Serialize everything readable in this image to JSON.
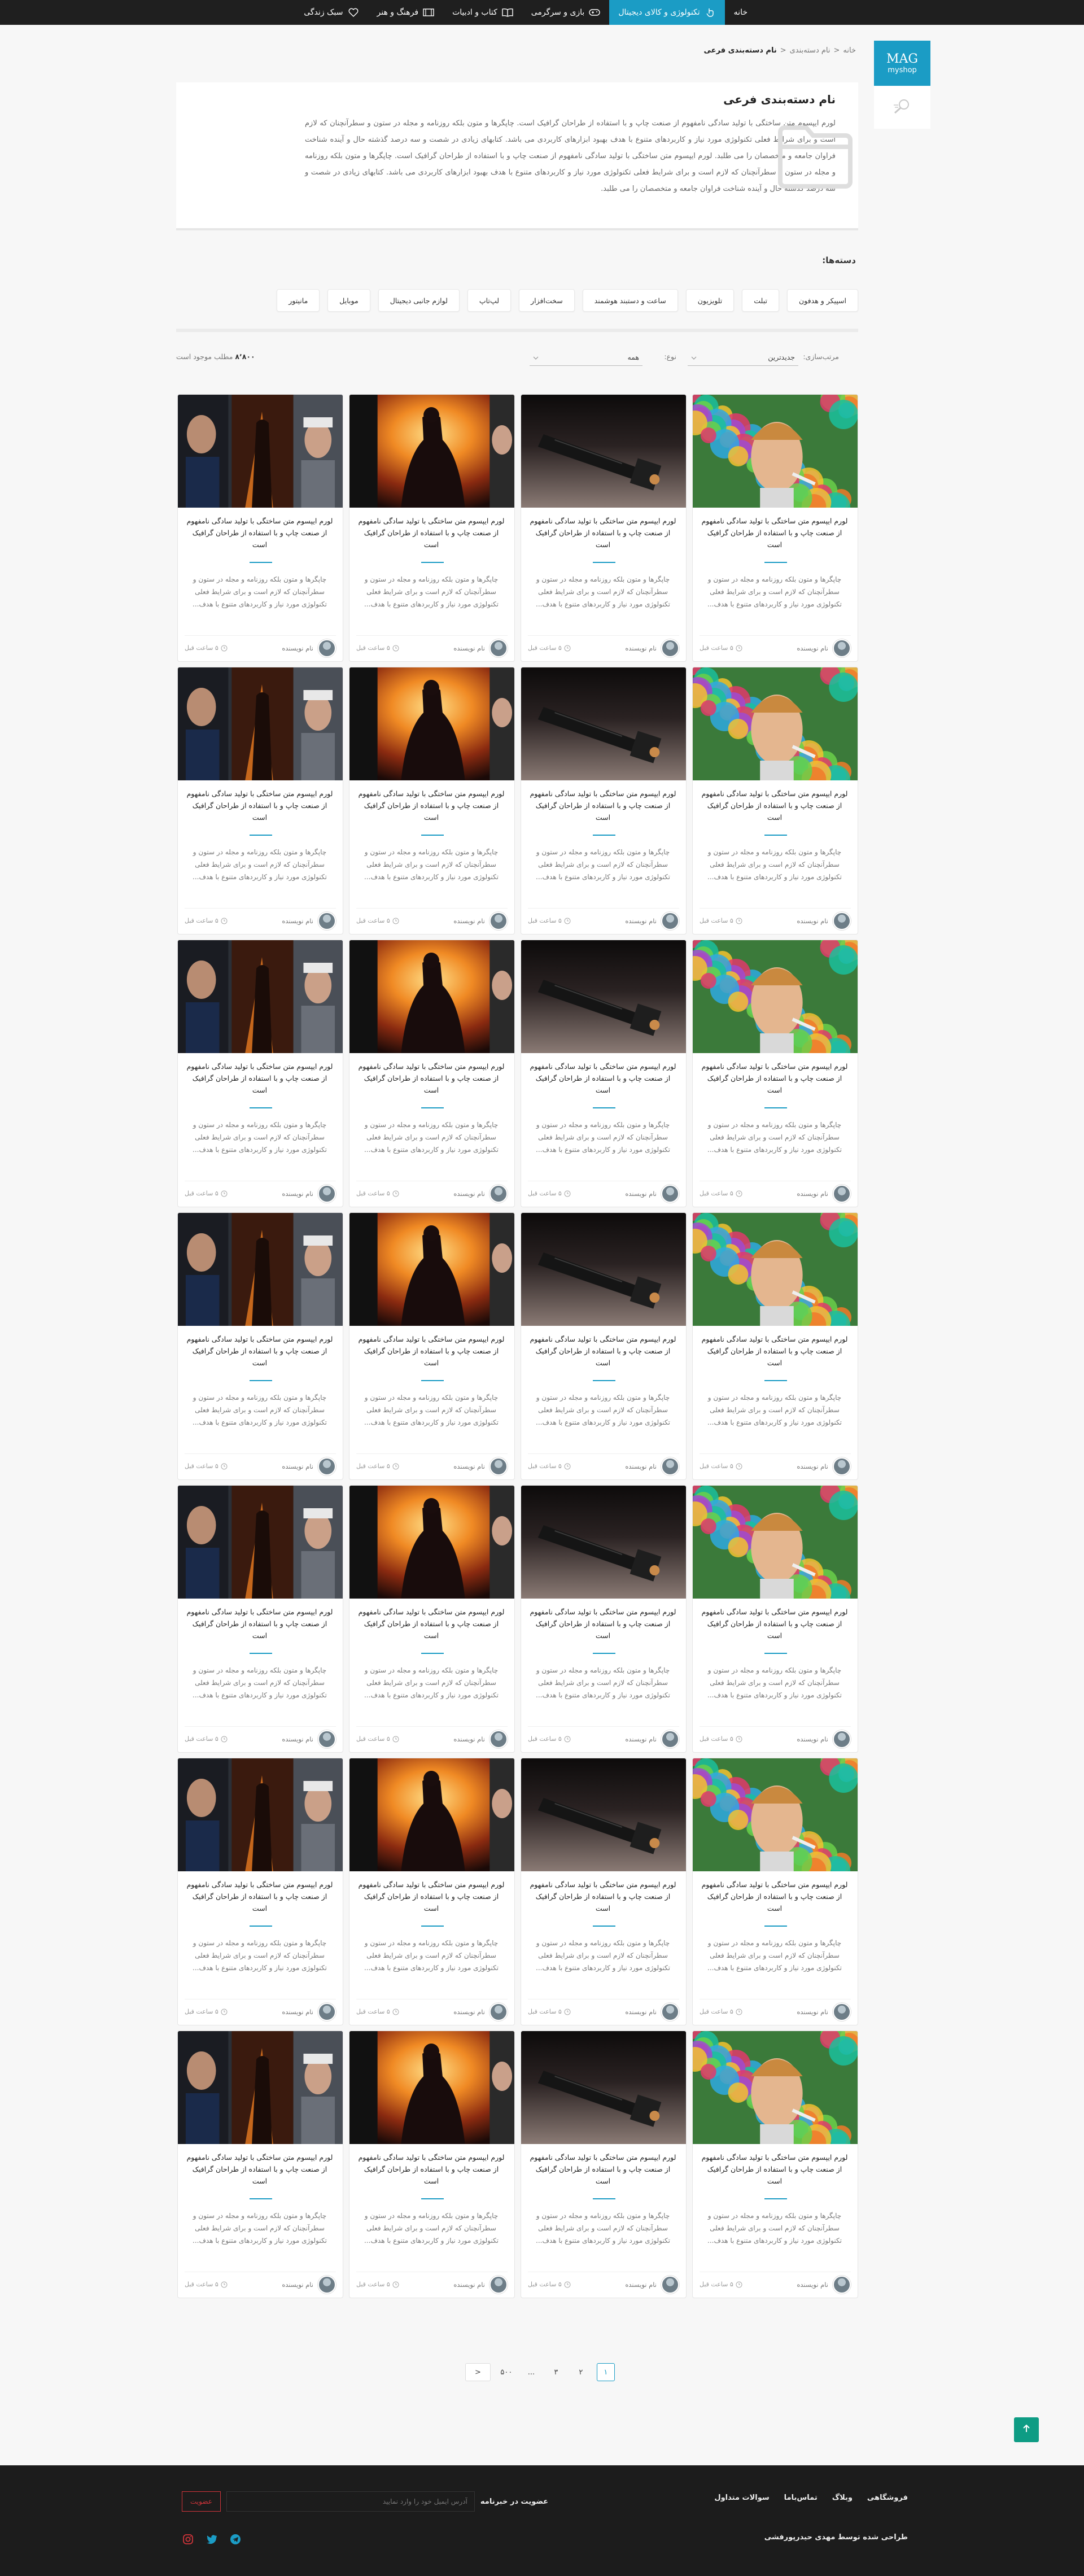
{
  "topnav": {
    "items": [
      {
        "label": "خانه",
        "icon": "home-icon",
        "active": false
      },
      {
        "label": "تکنولوژی و کالای دیجیتال",
        "icon": "hand-pointer-icon",
        "active": true
      },
      {
        "label": "بازی و سرگرمی",
        "icon": "gamepad-icon",
        "active": false
      },
      {
        "label": "کتاب و ادبیات",
        "icon": "book-icon",
        "active": false
      },
      {
        "label": "فرهنگ و هنر",
        "icon": "film-icon",
        "active": false
      },
      {
        "label": "سبک زندگی",
        "icon": "heart-icon",
        "active": false
      }
    ]
  },
  "logo": {
    "main": "MAG",
    "sub": "myshop"
  },
  "breadcrumb": {
    "home": "خانه",
    "sep": "<",
    "parent": "نام دسته‌بندی",
    "current": "نام دسته‌بندی فرعی"
  },
  "category": {
    "title": "نام دسته‌بندی فرعی",
    "description": "لورم ایپسوم متن ساختگی با تولید سادگی نامفهوم از صنعت چاپ و با استفاده از طراحان گرافیک است. چاپگرها و متون بلکه روزنامه و مجله در ستون و سطرآنچنان که لازم است و برای شرایط فعلی تکنولوژی مورد نیاز و کاربردهای متنوع با هدف بهبود ابزارهای کاربردی می باشد. کتابهای زیادی در شصت و سه درصد گذشته حال و آینده شناخت فراوان جامعه و متخصصان را می طلبد. لورم ایپسوم متن ساختگی با تولید سادگی نامفهوم از صنعت چاپ و با استفاده از طراحان گرافیک است. چاپگرها و متون بلکه روزنامه و مجله در ستون و سطرآنچنان که لازم است و برای شرایط فعلی تکنولوژی مورد نیاز و کاربردهای متنوع با هدف بهبود ابزارهای کاربردی می باشد. کتابهای زیادی در شصت و سه درصد گذشته حال و آینده شناخت فراوان جامعه و متخصصان را می طلبد."
  },
  "categories": {
    "label": "دسته‌ها:",
    "items": [
      "اسپیکر و هدفون",
      "تبلت",
      "تلویزیون",
      "ساعت و دستبند هوشمند",
      "سخت‌افزار",
      "لپ‌تاپ",
      "لوازم جانبی دیجیتال",
      "موبایل",
      "مانیتور"
    ]
  },
  "sort": {
    "label": "مرتب‌سازی:",
    "sort_value": "جدیدترین",
    "type_label": "نوع:",
    "type_value": "همه",
    "count_number": "۸٬۸۰۰",
    "count_suffix": "مطلب موجود است"
  },
  "card_text": {
    "title": "لورم ایپسوم متن ساختگی با تولید سادگی نامفهوم از صنعت چاپ و با استفاده از طراحان گرافیک است",
    "excerpt": "چاپگرها و متون بلکه روزنامه و مجله در ستون و سطرآنچنان که لازم است و برای شرایط فعلی تکنولوژی مورد نیاز و کاربردهای متنوع با هدف...",
    "author": "نام نویسنده",
    "time": "۵ ساعت قبل"
  },
  "card_images": [
    "colorful-portrait",
    "camera-device",
    "superhero-fire",
    "superhero-split"
  ],
  "pagination": {
    "items": [
      "۱",
      "۲",
      "۳",
      "...",
      "۵۰۰",
      ">"
    ],
    "active": "۱"
  },
  "footer": {
    "links": [
      "فروشگاهی",
      "وبلاگ",
      "تماس‌باما",
      "سوالات متداول"
    ],
    "credit": "طراحی شده توسط مهدی حیدرپورفشی",
    "newsletter_label": "عضویت در خبرنامه",
    "newsletter_placeholder": "آدرس ایمیل خود را وارد نمایید",
    "newsletter_button": "عضویت",
    "socials": [
      "instagram-icon",
      "twitter-icon",
      "telegram-icon"
    ]
  },
  "colors": {
    "accent": "#1b9cc5",
    "dark": "#1f1f1f",
    "to_top": "#0e9c84",
    "subscribe": "#d0343a"
  }
}
